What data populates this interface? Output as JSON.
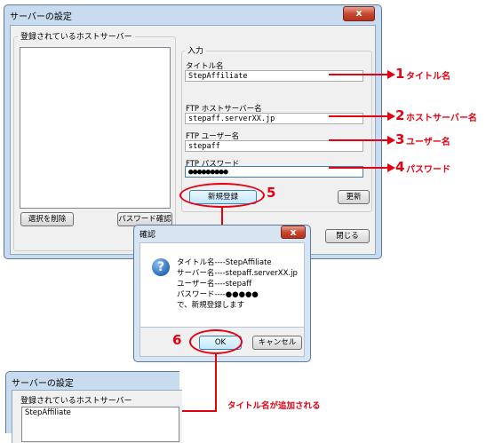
{
  "main_window": {
    "title": "サーバーの設定",
    "close_label": "x",
    "registered_group": "登録されているホストサーバー",
    "input_group": "入力",
    "title_label": "タイトル名",
    "title_value": "StepAffiliate",
    "host_label": "FTP ホストサーバー名",
    "host_value": "stepaff.serverXX.jp",
    "user_label": "FTP ユーザー名",
    "user_value": "stepaff",
    "password_label": "FTP パスワード",
    "password_value": "●●●●●●●●●",
    "new_register_button": "新規登録",
    "update_button": "更新",
    "delete_button": "選択を削除",
    "confirm_password_button": "パスワード確認",
    "close_button": "閉じる"
  },
  "dialog": {
    "title": "確認",
    "close_label": "x",
    "icon": "question-icon",
    "lines": [
      "タイトル名----StepAffiliate",
      "サーバー名----stepaff.serverXX.jp",
      "ユーザー名----stepaff",
      "パスワード----●●●●●",
      "で、新規登録します"
    ],
    "ok_button": "OK",
    "cancel_button": "キャンセル"
  },
  "result_window": {
    "title": "サーバーの設定",
    "registered_group": "登録されているホストサーバー",
    "list_items": [
      "StepAffiliate"
    ]
  },
  "annotations": {
    "n1": "1",
    "a1": "タイトル名",
    "n2": "2",
    "a2": "ホストサーバー名",
    "n3": "3",
    "a3": "ユーザー名",
    "n4": "4",
    "a4": "パスワード",
    "n5": "5",
    "n6": "6",
    "added": "タイトル名が追加される",
    "accent_color": "#e60012"
  }
}
